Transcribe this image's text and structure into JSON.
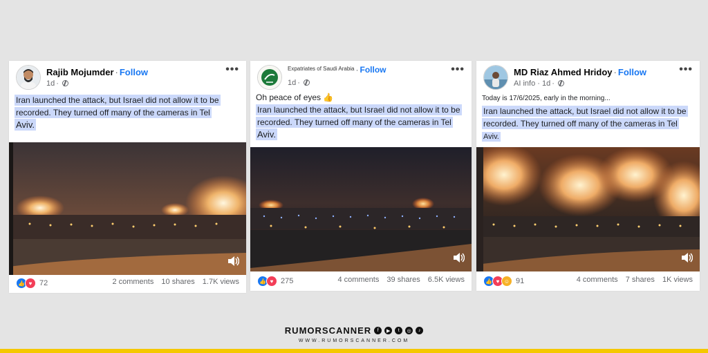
{
  "posts": [
    {
      "author": "Rajib Mojumder",
      "follow_label": "Follow",
      "meta": "1d",
      "text_lines": [
        "Iran launched the attack, but Israel did not allow it to be",
        "recorded. They turned off many of the cameras in Tel",
        "Aviv."
      ],
      "reaction_count": "72",
      "comments": "2 comments",
      "shares": "10 shares",
      "views": "1.7K views",
      "reactions": [
        "like-icon",
        "love-icon"
      ]
    },
    {
      "author": "Expatriates of Saudi Arabia",
      "follow_label": "Follow",
      "meta": "1d",
      "text_lines": [
        "Oh peace of eyes 👍",
        "Iran launched the attack, but Israel did not allow it to be",
        "recorded. They turned off many of the cameras in Tel",
        "Aviv."
      ],
      "reaction_count": "275",
      "comments": "4 comments",
      "shares": "39 shares",
      "views": "6.5K views",
      "reactions": [
        "like-icon",
        "love-icon"
      ]
    },
    {
      "author": "MD Riaz Ahmed Hridoy",
      "follow_label": "Follow",
      "meta": "AI info · 1d",
      "text_lines": [
        "Today is 17/6/2025, early in the morning...",
        "Iran launched the attack, but Israel did not allow it to be",
        "recorded. They turned off many of the cameras in Tel",
        "Aviv."
      ],
      "reaction_count": "91",
      "comments": "4 comments",
      "shares": "7 shares",
      "views": "1K views",
      "reactions": [
        "like-icon",
        "love-icon",
        "care-icon"
      ]
    }
  ],
  "brand": {
    "name": "RUMORSCANNER",
    "url": "WWW.RUMORSCANNER.COM",
    "social_icons": [
      "facebook-icon",
      "youtube-icon",
      "twitter-icon",
      "instagram-icon",
      "tiktok-icon"
    ]
  },
  "colors": {
    "background": "#e4e4e4",
    "follow": "#1877f2",
    "highlight": "#a0b9f5",
    "accent_bar": "#f5c800"
  }
}
